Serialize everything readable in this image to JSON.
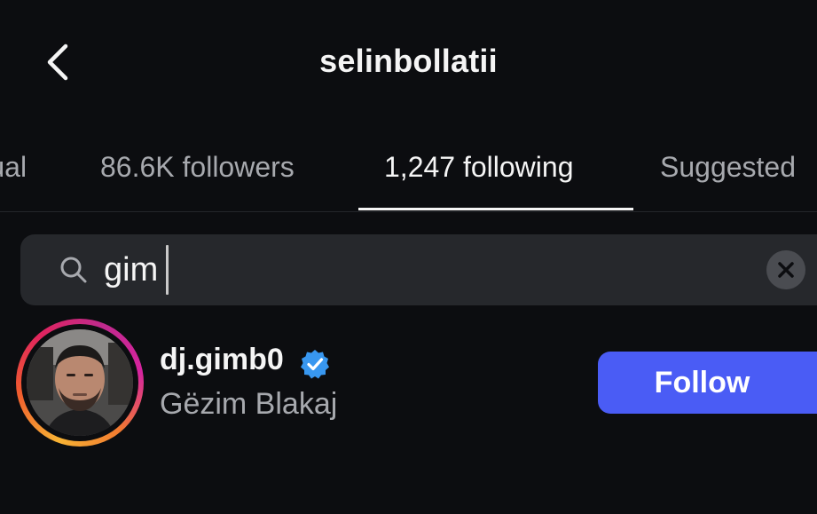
{
  "header": {
    "title": "selinbollatii",
    "back_icon": "chevron-left-icon"
  },
  "tabs": [
    {
      "label": "Mutual",
      "active": false
    },
    {
      "label": "86.6K followers",
      "active": false
    },
    {
      "label": "1,247 following",
      "active": true
    },
    {
      "label": "Suggested",
      "active": false
    }
  ],
  "search": {
    "value": "gim",
    "icon": "search-icon",
    "clear_icon": "close-icon"
  },
  "results": [
    {
      "username": "dj.gimb0",
      "full_name": "Gëzim Blakaj",
      "verified": true,
      "follow_label": "Follow"
    }
  ],
  "colors": {
    "background": "#0c0d10",
    "follow_button": "#4a5cf5",
    "verified_badge": "#3897f0",
    "secondary_text": "#a7a9ae",
    "search_bg": "#26282c"
  }
}
